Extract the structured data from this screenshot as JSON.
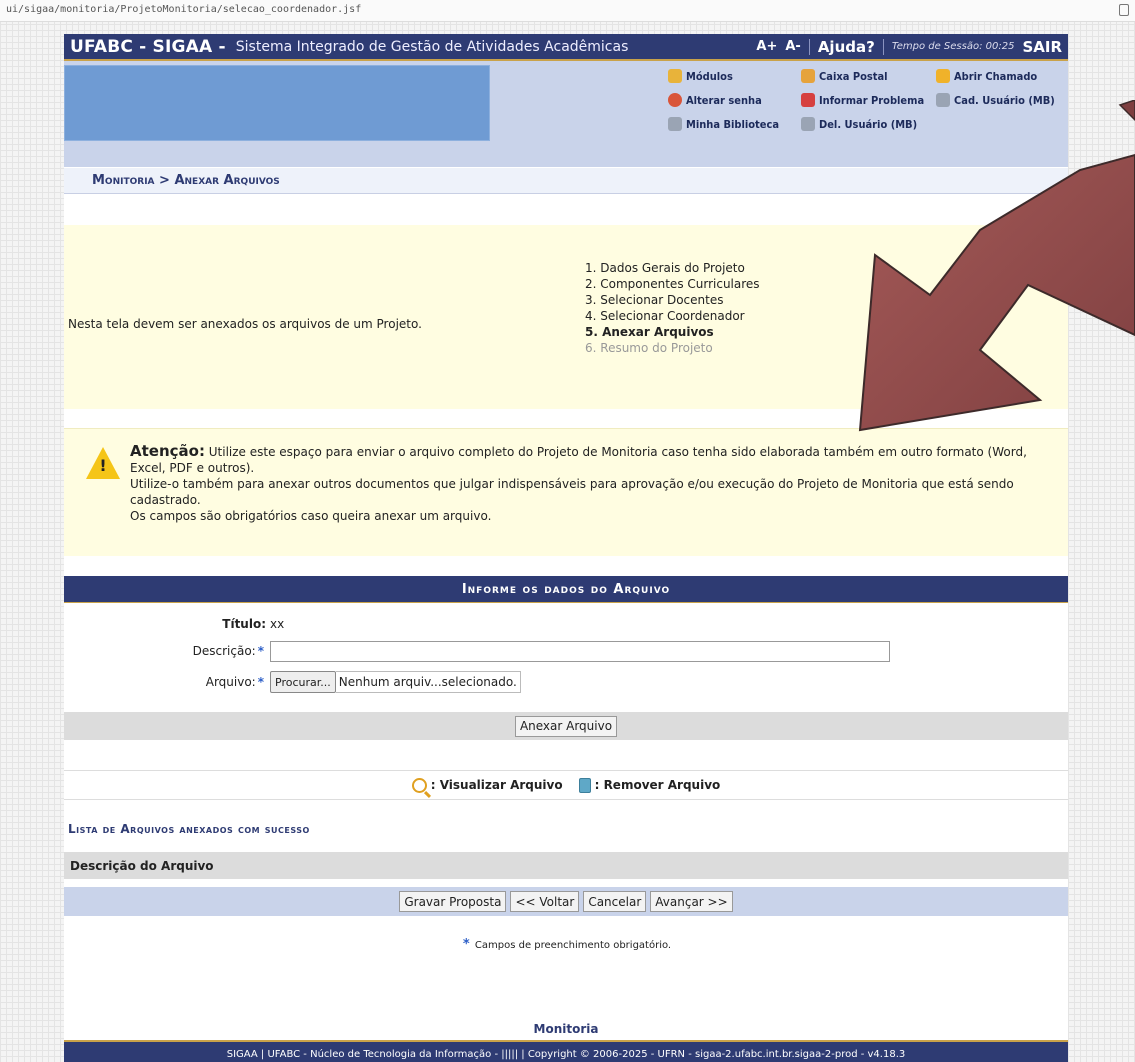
{
  "browser": {
    "url": "ui/sigaa/monitoria/ProjetoMonitoria/selecao_coordenador.jsf"
  },
  "header": {
    "brand": "UFABC - SIGAA -",
    "system_name": "Sistema Integrado de Gestão de Atividades Acadêmicas",
    "font_plus": "A+",
    "font_minus": "A-",
    "help": "Ajuda?",
    "session_label": "Tempo de Sessão: 00:25",
    "logout": "SAIR"
  },
  "menu": {
    "modulos": "Módulos",
    "caixa_postal": "Caixa Postal",
    "abrir_chamado": "Abrir Chamado",
    "alterar_senha": "Alterar senha",
    "informar_problema": "Informar Problema",
    "cad_usuario": "Cad. Usuário (MB)",
    "minha_biblioteca": "Minha Biblioteca",
    "del_usuario": "Del. Usuário (MB)"
  },
  "breadcrumb": "Monitoria > Anexar Arquivos",
  "intro": {
    "text": "Nesta tela devem ser anexados os arquivos de um Projeto.",
    "steps": [
      "1. Dados Gerais do Projeto",
      "2. Componentes Curriculares",
      "3. Selecionar Docentes",
      "4. Selecionar Coordenador",
      "5. Anexar Arquivos",
      "6. Resumo do Projeto"
    ]
  },
  "warning": {
    "lead": "Atenção:",
    "line1": " Utilize este espaço para enviar o arquivo completo do Projeto de Monitoria caso tenha sido elaborada também em outro formato (Word, Excel, PDF e outros).",
    "line2": "Utilize-o também para anexar outros documentos que julgar indispensáveis para aprovação e/ou execução do Projeto de Monitoria que está sendo cadastrado.",
    "line3": "Os campos são obrigatórios caso queira anexar um arquivo."
  },
  "form": {
    "header": "Informe os dados do Arquivo",
    "titulo_label": "Título:",
    "titulo_value": "xx",
    "descricao_label": "Descrição:",
    "descricao_value": "",
    "arquivo_label": "Arquivo:",
    "browse_button": "Procurar...",
    "no_file": "Nenhum arquiv...selecionado.",
    "attach_button": "Anexar Arquivo",
    "required_marker": "*"
  },
  "legend": {
    "view": ": Visualizar Arquivo",
    "remove": ": Remover Arquivo"
  },
  "list": {
    "title": "Lista de Arquivos anexados com sucesso",
    "column": "Descrição do Arquivo"
  },
  "nav": {
    "save": "Gravar Proposta",
    "back": "<< Voltar",
    "cancel": "Cancelar",
    "next": "Avançar >>"
  },
  "required_note": "Campos de preenchimento obrigatório.",
  "footer": {
    "module": "Monitoria",
    "text": "SIGAA | UFABC - Núcleo de Tecnologia da Informação - ||||| | Copyright © 2006-2025 - UFRN - sigaa-2.ufabc.int.br.sigaa-2-prod - v4.18.3"
  },
  "colors": {
    "brand_navy": "#2e3b73",
    "header_light": "#c9d3ea",
    "notice_yellow": "#fffde1",
    "arrow": "#8b4a4a"
  }
}
